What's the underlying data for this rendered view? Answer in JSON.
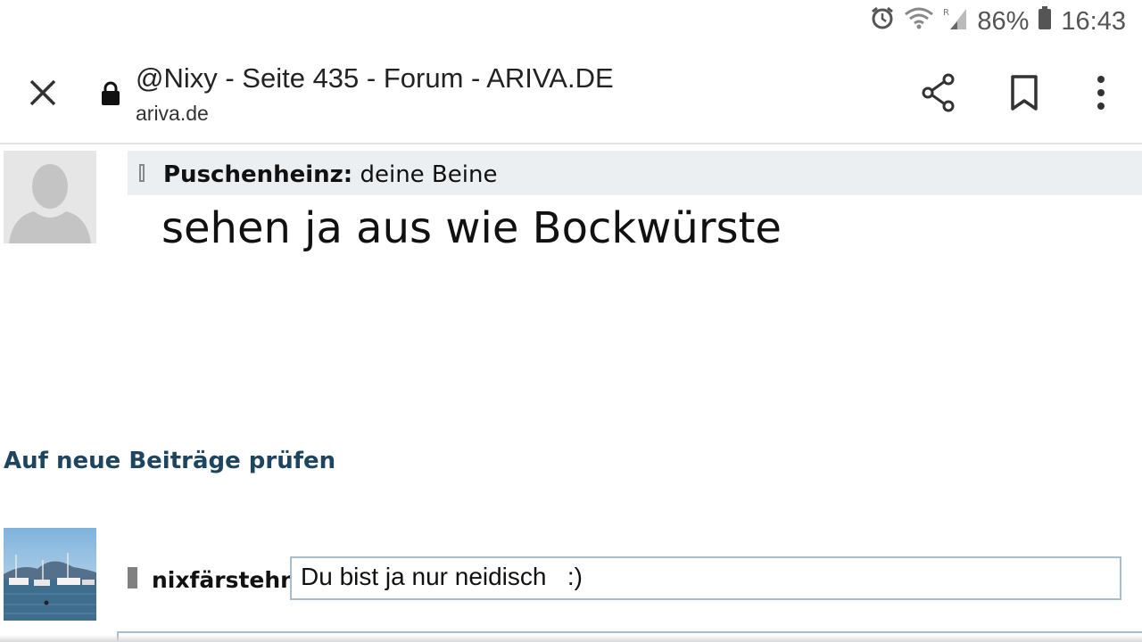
{
  "status_bar": {
    "battery_percent": "86%",
    "time": "16:43",
    "icons": [
      "alarm-icon",
      "wifi-icon",
      "signal-icon",
      "battery-icon"
    ]
  },
  "toolbar": {
    "page_title": "@Nixy - Seite 435 - Forum - ARIVA.DE",
    "domain": "ariva.de",
    "icons": [
      "close-icon",
      "lock-icon",
      "share-icon",
      "bookmark-icon",
      "more-vert-icon"
    ]
  },
  "post": {
    "quote_author": "Puschenheinz:",
    "quote_text": "deine Beine",
    "body": "sehen ja aus wie Bockwürste"
  },
  "check_new_link": "Auf neue Beiträge prüfen",
  "reply": {
    "username": "nixfärstehn:",
    "text": "Du bist ja nur neidisch   :)"
  },
  "colors": {
    "link": "#1d4560",
    "quote_background": "#eceff2",
    "input_border": "#a9bdd0"
  }
}
